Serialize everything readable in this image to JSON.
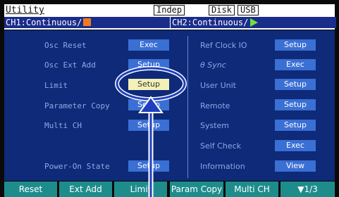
{
  "header": {
    "title": "Utility",
    "indep": "Indep",
    "disk": "Disk",
    "usb": "USB",
    "ch1": "CH1:Continuous/",
    "ch2": "CH2:Continuous/"
  },
  "left_items": [
    {
      "label": "Osc Reset",
      "button": "Exec"
    },
    {
      "label": "Osc Ext Add",
      "button": "Setup"
    },
    {
      "label": "Limit",
      "button": "Setup"
    },
    {
      "label": "Parameter Copy",
      "button": "Setup"
    },
    {
      "label": "Multi CH",
      "button": "Setup"
    },
    {
      "label": "Power-On State",
      "button": "Setup"
    }
  ],
  "right_items": [
    {
      "label": "Ref Clock IO",
      "button": "Setup"
    },
    {
      "label": "θ Sync",
      "button": "Exec"
    },
    {
      "label": "User Unit",
      "button": "Setup"
    },
    {
      "label": "Remote",
      "button": "Setup"
    },
    {
      "label": "System",
      "button": "Setup"
    },
    {
      "label": "Self Check",
      "button": "Exec"
    },
    {
      "label": "Information",
      "button": "View"
    }
  ],
  "softkeys": [
    "Reset",
    "Ext Add",
    "Limit",
    "Param Copy",
    "Multi CH",
    "▼1/3"
  ],
  "colors": {
    "accent": "#1f3fbf",
    "panel": "#0e2a78",
    "button": "#3a6fd4",
    "highlight": "#f3f0b8",
    "softkey": "#1f8c8c"
  }
}
